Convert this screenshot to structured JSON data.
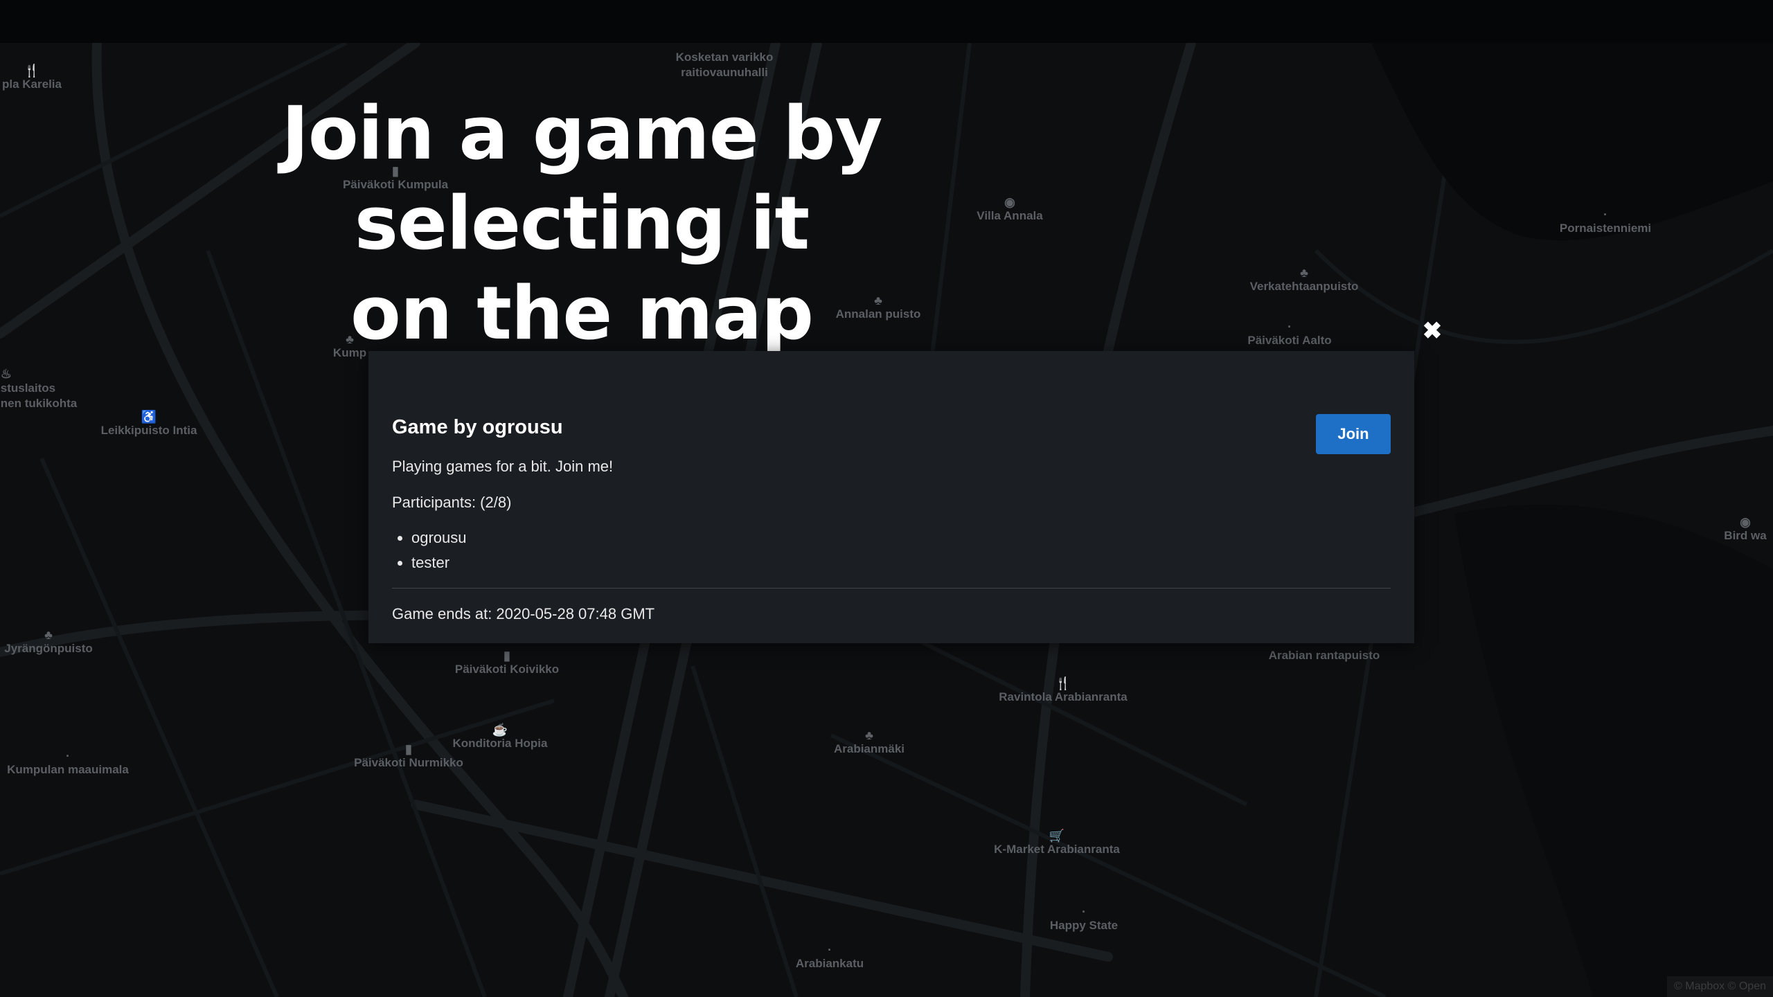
{
  "headline": {
    "line1": "Join a game by selecting it",
    "line2": "on the map"
  },
  "modal": {
    "title": "Game by ogrousu",
    "join_label": "Join",
    "close_glyph": "✖",
    "description": "Playing games for a bit. Join me!",
    "participants_label": "Participants: (2/8)",
    "participants": [
      "ogrousu",
      "tester"
    ],
    "ends_at": "Game ends at: 2020-05-28 07:48 GMT"
  },
  "map": {
    "places": [
      {
        "label": "Kosketan varikko\nraitiovaunuhalli",
        "icon": ""
      },
      {
        "label": "pla Karelia",
        "icon": "restaurant-icon"
      },
      {
        "label": "Päiväkoti Kumpula",
        "icon": "school-icon"
      },
      {
        "label": "Villa Annala",
        "icon": "camera-icon"
      },
      {
        "label": "Pornaistenniemi",
        "icon": ""
      },
      {
        "label": "Verkatehtaanpuisto",
        "icon": "park-icon"
      },
      {
        "label": "Annalan puisto",
        "icon": "park-icon"
      },
      {
        "label": "Päiväkoti Aalto",
        "icon": ""
      },
      {
        "label": "Kump",
        "icon": "park-icon"
      },
      {
        "label": "stuslaitos\nnen tukikohta",
        "icon": "fire-station-icon"
      },
      {
        "label": "Leikkipuisto Intia",
        "icon": "playground-icon"
      },
      {
        "label": "Bird wa",
        "icon": "camera-icon"
      },
      {
        "label": "Jyrängönpuisto",
        "icon": "park-icon"
      },
      {
        "label": "Päiväkoti Koivikko",
        "icon": "school-icon"
      },
      {
        "label": "Arabian rantapuisto",
        "icon": ""
      },
      {
        "label": "Ravintola Arabianranta",
        "icon": "restaurant-icon"
      },
      {
        "label": "Konditoria Hopia",
        "icon": "cafe-icon"
      },
      {
        "label": "Arabianmäki",
        "icon": "park-icon"
      },
      {
        "label": "Kumpulan maauimala",
        "icon": ""
      },
      {
        "label": "Päiväkoti Nurmikko",
        "icon": "school-icon"
      },
      {
        "label": "K-Market Arabianranta",
        "icon": "shop-icon"
      },
      {
        "label": "Happy State",
        "icon": ""
      },
      {
        "label": "Arabiankatu",
        "icon": ""
      }
    ],
    "attribution": "© Mapbox © Open"
  }
}
